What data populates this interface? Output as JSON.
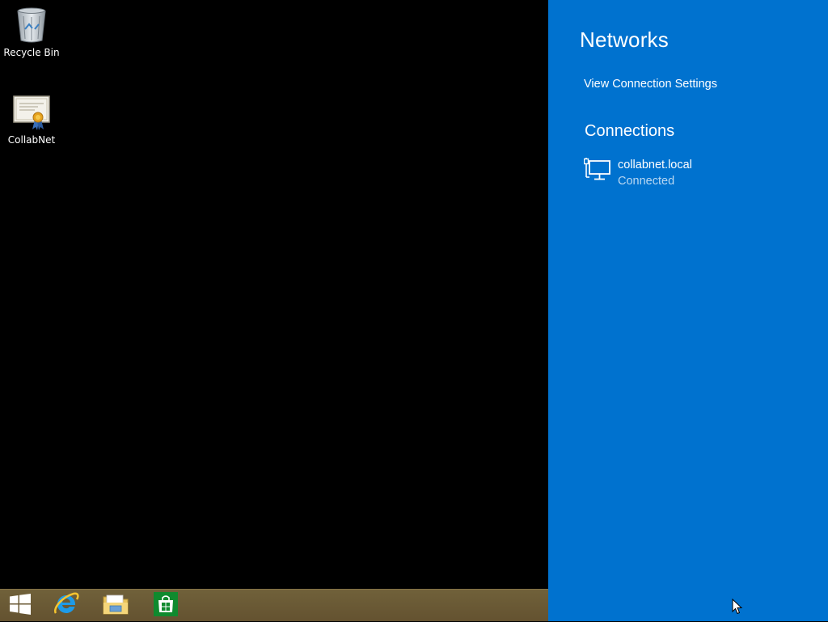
{
  "desktop": {
    "icons": [
      {
        "label": "Recycle Bin",
        "icon": "recycle-bin-icon"
      },
      {
        "label": "CollabNet",
        "icon": "certificate-icon"
      }
    ]
  },
  "taskbar": {
    "buttons": [
      {
        "name": "start",
        "icon": "windows-logo-icon"
      },
      {
        "name": "internet-explorer",
        "icon": "internet-explorer-icon"
      },
      {
        "name": "file-explorer",
        "icon": "folder-icon"
      },
      {
        "name": "store",
        "icon": "store-icon"
      }
    ],
    "background": "#6b5a2e"
  },
  "charm": {
    "title": "Networks",
    "view_settings_link": "View Connection Settings",
    "connections_heading": "Connections",
    "connections": [
      {
        "name": "collabnet.local",
        "status": "Connected",
        "icon": "wired-network-icon"
      }
    ],
    "background": "#0072cf",
    "status_color": "#b9d8f2"
  }
}
